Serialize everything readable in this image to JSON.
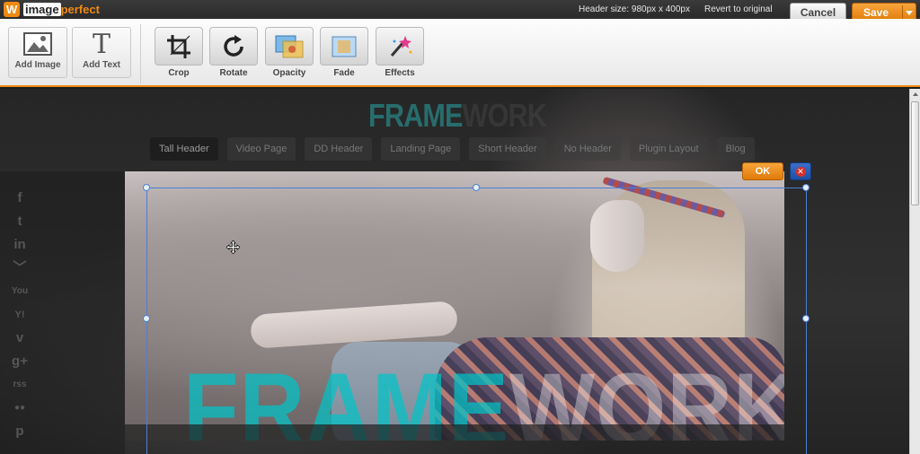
{
  "app": {
    "logo_letter": "W",
    "logo_part1": "image",
    "logo_part2": "perfect",
    "header_size": "Header size: 980px x 400px",
    "revert": "Revert to original",
    "cancel": "Cancel",
    "save": "Save"
  },
  "toolbar": {
    "add_image": "Add Image",
    "add_text": "Add Text",
    "add_text_glyph": "T",
    "tools": [
      "Crop",
      "Rotate",
      "Opacity",
      "Fade",
      "Effects"
    ]
  },
  "site": {
    "logo_a": "FRAME",
    "logo_b": "WORK",
    "nav": [
      "Tall Header",
      "Video Page",
      "DD Header",
      "Landing Page",
      "Short Header",
      "No Header",
      "Plugin Layout",
      "Blog"
    ],
    "social": [
      "f",
      "t",
      "in",
      "﹀",
      "You",
      "Y!",
      "v",
      "g+",
      "rss",
      "●●",
      "p"
    ]
  },
  "crop": {
    "ok": "OK",
    "close_glyph": "✕"
  },
  "photo": {
    "watermark_a": "FRAME",
    "watermark_b": "WORK"
  },
  "colors": {
    "accent": "#f08a10",
    "crop_frame": "#4a7fd6",
    "brand_teal": "#2aa7a7"
  }
}
